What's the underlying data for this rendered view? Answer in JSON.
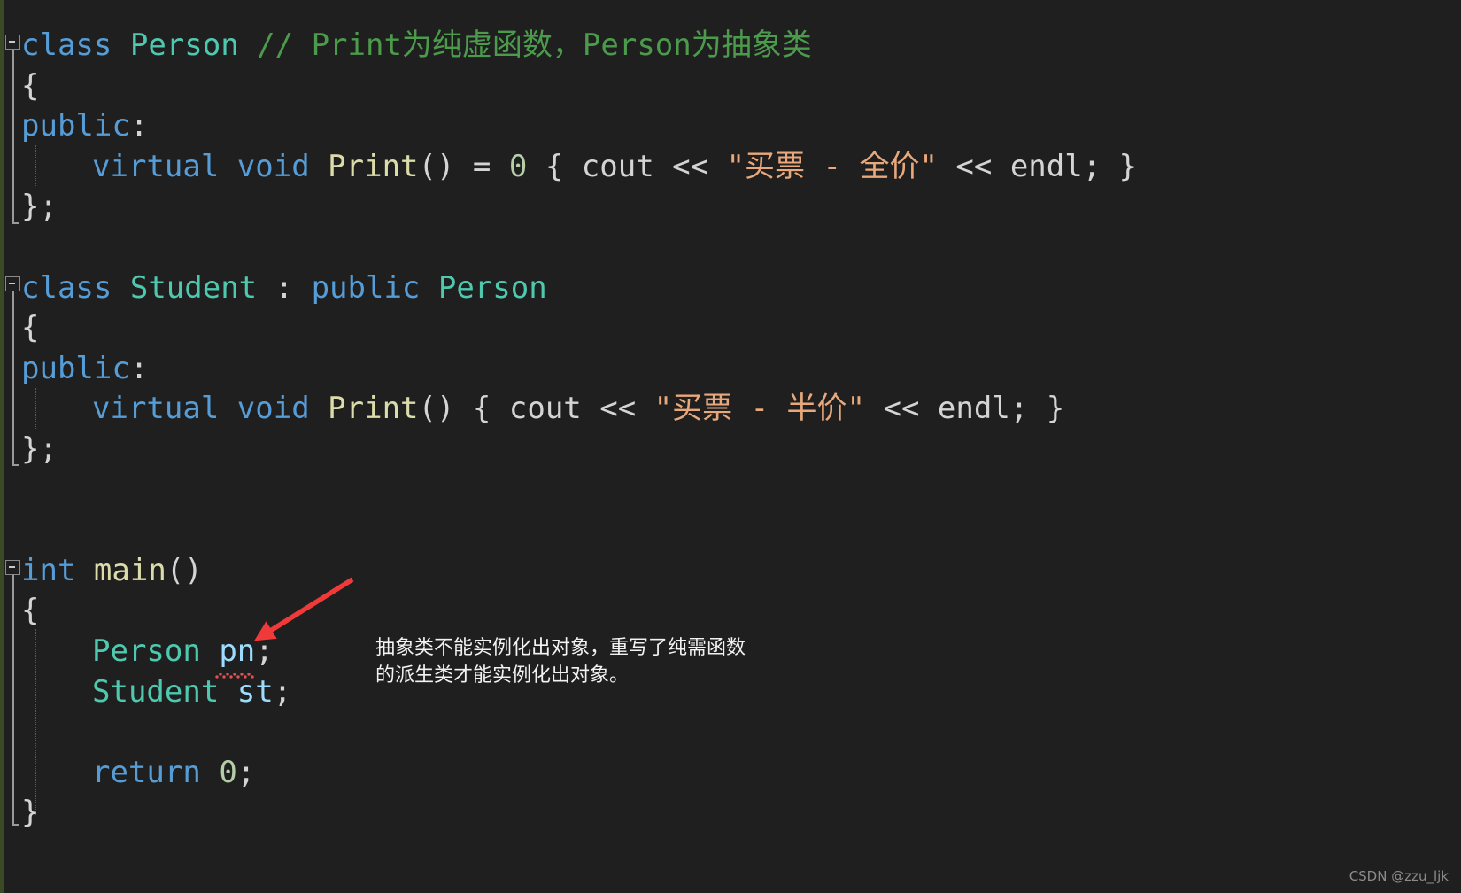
{
  "editor": {
    "background": "#1f1f1f",
    "language": "cpp",
    "colors": {
      "keyword": "#569CD6",
      "type": "#4EC9B0",
      "function": "#DCDCAA",
      "comment": "#4C9A4C",
      "string": "#E8A87C",
      "number": "#B5CEA8",
      "plain": "#D4D4D4",
      "variable": "#9CDCFE",
      "error": "#e05050",
      "annotation_arrow": "#F03A3A"
    },
    "code_lines": [
      {
        "id": "line-class-person",
        "indent": 0,
        "tokens": [
          {
            "text": "class",
            "kind": "keyword"
          },
          {
            "text": " ",
            "kind": "plain"
          },
          {
            "text": "Person",
            "kind": "type"
          },
          {
            "text": " ",
            "kind": "plain"
          },
          {
            "text": "// Print为纯虚函数，Person为抽象类",
            "kind": "comment"
          }
        ]
      },
      {
        "id": "line-person-open-brace",
        "indent": 0,
        "tokens": [
          {
            "text": "{",
            "kind": "plain"
          }
        ]
      },
      {
        "id": "line-person-public",
        "indent": 0,
        "tokens": [
          {
            "text": "public",
            "kind": "keyword"
          },
          {
            "text": ":",
            "kind": "plain"
          }
        ]
      },
      {
        "id": "line-person-print",
        "indent": 1,
        "tokens": [
          {
            "text": "virtual",
            "kind": "keyword"
          },
          {
            "text": " ",
            "kind": "plain"
          },
          {
            "text": "void",
            "kind": "keyword"
          },
          {
            "text": " ",
            "kind": "plain"
          },
          {
            "text": "Print",
            "kind": "function"
          },
          {
            "text": "() = ",
            "kind": "plain"
          },
          {
            "text": "0",
            "kind": "number"
          },
          {
            "text": " { ",
            "kind": "plain"
          },
          {
            "text": "cout",
            "kind": "plain"
          },
          {
            "text": " << ",
            "kind": "plain"
          },
          {
            "text": "\"买票 - 全价\"",
            "kind": "string"
          },
          {
            "text": " << ",
            "kind": "plain"
          },
          {
            "text": "endl",
            "kind": "plain"
          },
          {
            "text": "; }",
            "kind": "plain"
          }
        ]
      },
      {
        "id": "line-person-close-brace",
        "indent": 0,
        "tokens": [
          {
            "text": "};",
            "kind": "plain"
          }
        ]
      },
      {
        "id": "line-blank-1",
        "indent": 0,
        "tokens": []
      },
      {
        "id": "line-class-student",
        "indent": 0,
        "tokens": [
          {
            "text": "class",
            "kind": "keyword"
          },
          {
            "text": " ",
            "kind": "plain"
          },
          {
            "text": "Student",
            "kind": "type"
          },
          {
            "text": " : ",
            "kind": "plain"
          },
          {
            "text": "public",
            "kind": "keyword"
          },
          {
            "text": " ",
            "kind": "plain"
          },
          {
            "text": "Person",
            "kind": "type"
          }
        ]
      },
      {
        "id": "line-student-open-brace",
        "indent": 0,
        "tokens": [
          {
            "text": "{",
            "kind": "plain"
          }
        ]
      },
      {
        "id": "line-student-public",
        "indent": 0,
        "tokens": [
          {
            "text": "public",
            "kind": "keyword"
          },
          {
            "text": ":",
            "kind": "plain"
          }
        ]
      },
      {
        "id": "line-student-print",
        "indent": 1,
        "tokens": [
          {
            "text": "virtual",
            "kind": "keyword"
          },
          {
            "text": " ",
            "kind": "plain"
          },
          {
            "text": "void",
            "kind": "keyword"
          },
          {
            "text": " ",
            "kind": "plain"
          },
          {
            "text": "Print",
            "kind": "function"
          },
          {
            "text": "() { ",
            "kind": "plain"
          },
          {
            "text": "cout",
            "kind": "plain"
          },
          {
            "text": " << ",
            "kind": "plain"
          },
          {
            "text": "\"买票 - 半价\"",
            "kind": "string"
          },
          {
            "text": " << ",
            "kind": "plain"
          },
          {
            "text": "endl",
            "kind": "plain"
          },
          {
            "text": "; }",
            "kind": "plain"
          }
        ]
      },
      {
        "id": "line-student-close-brace",
        "indent": 0,
        "tokens": [
          {
            "text": "};",
            "kind": "plain"
          }
        ]
      },
      {
        "id": "line-blank-2",
        "indent": 0,
        "tokens": []
      },
      {
        "id": "line-blank-3",
        "indent": 0,
        "tokens": []
      },
      {
        "id": "line-int-main",
        "indent": 0,
        "tokens": [
          {
            "text": "int",
            "kind": "keyword"
          },
          {
            "text": " ",
            "kind": "plain"
          },
          {
            "text": "main",
            "kind": "function"
          },
          {
            "text": "()",
            "kind": "plain"
          }
        ]
      },
      {
        "id": "line-main-open-brace",
        "indent": 0,
        "tokens": [
          {
            "text": "{",
            "kind": "plain"
          }
        ]
      },
      {
        "id": "line-person-pn",
        "indent": 1,
        "tokens": [
          {
            "text": "Person",
            "kind": "type"
          },
          {
            "text": " ",
            "kind": "plain"
          },
          {
            "text": "pn",
            "kind": "variable"
          },
          {
            "text": ";",
            "kind": "plain"
          }
        ]
      },
      {
        "id": "line-student-st",
        "indent": 1,
        "tokens": [
          {
            "text": "Student",
            "kind": "type"
          },
          {
            "text": " ",
            "kind": "plain"
          },
          {
            "text": "st",
            "kind": "variable"
          },
          {
            "text": ";",
            "kind": "plain"
          }
        ]
      },
      {
        "id": "line-blank-4",
        "indent": 0,
        "tokens": []
      },
      {
        "id": "line-return",
        "indent": 1,
        "tokens": [
          {
            "text": "return",
            "kind": "keyword"
          },
          {
            "text": " ",
            "kind": "plain"
          },
          {
            "text": "0",
            "kind": "number"
          },
          {
            "text": ";",
            "kind": "plain"
          }
        ]
      },
      {
        "id": "line-main-close-brace",
        "indent": 0,
        "tokens": [
          {
            "text": "}",
            "kind": "plain"
          }
        ]
      }
    ]
  },
  "error_marker": {
    "target_token": "pn",
    "type": "red-squiggle-underline",
    "message_hint": "abstract class cannot be instantiated"
  },
  "annotation": {
    "text": "抽象类不能实例化出对象，重写了纯需函数\n的派生类才能实例化出对象。",
    "arrow_color": "#F03A3A",
    "arrow_points_to": "Person pn;"
  },
  "watermark": {
    "text": "CSDN @zzu_ljk"
  }
}
